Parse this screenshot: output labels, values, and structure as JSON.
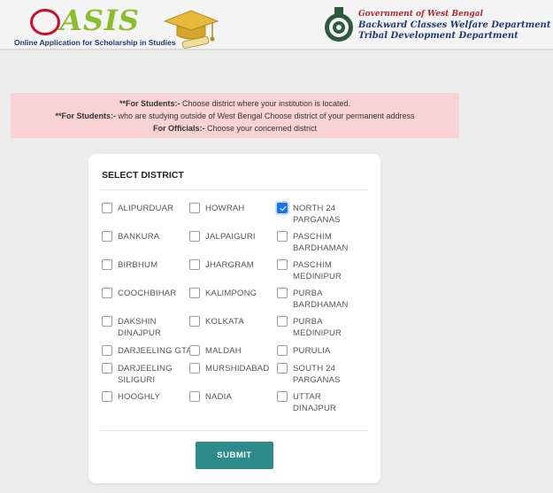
{
  "header": {
    "logo_text": "ASIS",
    "logo_subtitle": "Online Application for Scholarship in Studies",
    "govt_line1": "Government of West Bengal",
    "govt_line2": "Backward Classes Welfare Department",
    "govt_line3": "Tribal Development Department"
  },
  "notice": {
    "line1_prefix": "**For Students:-",
    "line1_text": " Choose district where your institution is located.",
    "line2_prefix": "**For Students:-",
    "line2_text": " who are studying outside of West Bengal Choose district of your permanent address",
    "line3_prefix": "For Officials:-",
    "line3_text": " Choose your concerned district"
  },
  "form": {
    "title": "SELECT DISTRICT",
    "submit_label": "SUBMIT",
    "districts": [
      {
        "label": "ALIPURDUAR",
        "checked": false
      },
      {
        "label": "HOWRAH",
        "checked": false
      },
      {
        "label": "NORTH 24 PARGANAS",
        "checked": true
      },
      {
        "label": "BANKURA",
        "checked": false
      },
      {
        "label": "JALPAIGURI",
        "checked": false
      },
      {
        "label": "PASCHIM BARDHAMAN",
        "checked": false
      },
      {
        "label": "BIRBHUM",
        "checked": false
      },
      {
        "label": "JHARGRAM",
        "checked": false
      },
      {
        "label": "PASCHIM MEDINIPUR",
        "checked": false
      },
      {
        "label": "COOCHBIHAR",
        "checked": false
      },
      {
        "label": "KALIMPONG",
        "checked": false
      },
      {
        "label": "PURBA BARDHAMAN",
        "checked": false
      },
      {
        "label": "DAKSHIN DINAJPUR",
        "checked": false
      },
      {
        "label": "KOLKATA",
        "checked": false
      },
      {
        "label": "PURBA MEDINIPUR",
        "checked": false
      },
      {
        "label": "DARJEELING GTA",
        "checked": false
      },
      {
        "label": "MALDAH",
        "checked": false
      },
      {
        "label": "PURULIA",
        "checked": false
      },
      {
        "label": "DARJEELING SILIGURI",
        "checked": false
      },
      {
        "label": "MURSHIDABAD",
        "checked": false
      },
      {
        "label": "SOUTH 24 PARGANAS",
        "checked": false
      },
      {
        "label": "HOOGHLY",
        "checked": false
      },
      {
        "label": "NADIA",
        "checked": false
      },
      {
        "label": "UTTAR DINAJPUR",
        "checked": false
      }
    ]
  }
}
